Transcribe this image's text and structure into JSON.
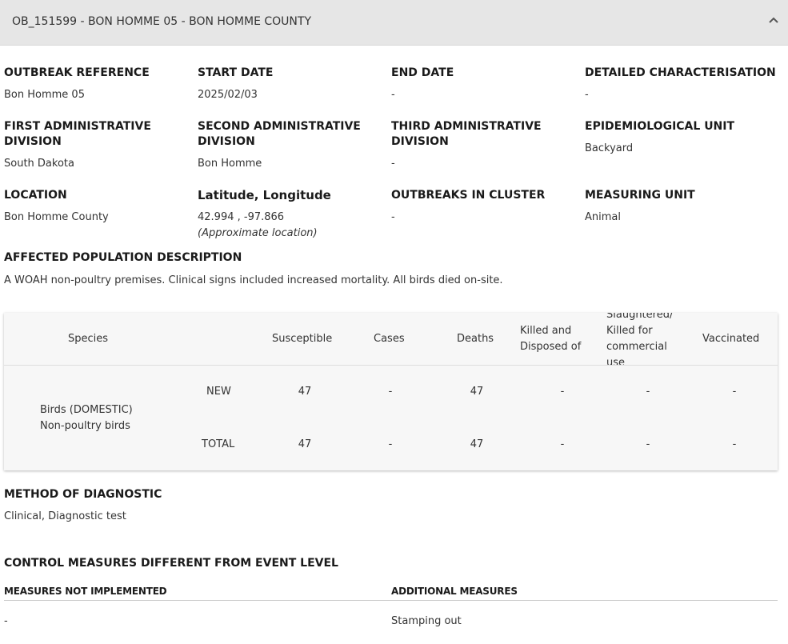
{
  "header": {
    "title": "OB_151599 - BON HOMME 05 - BON HOMME COUNTY"
  },
  "fields": {
    "outbreak_reference": {
      "label": "OUTBREAK REFERENCE",
      "value": "Bon Homme 05"
    },
    "start_date": {
      "label": "START DATE",
      "value": "2025/02/03"
    },
    "end_date": {
      "label": "END DATE",
      "value": "-"
    },
    "detailed_characterisation": {
      "label": "DETAILED CHARACTERISATION",
      "value": "-"
    },
    "first_admin": {
      "label_line1": "FIRST ADMINISTRATIVE",
      "label_line2": "DIVISION",
      "value": "South Dakota"
    },
    "second_admin": {
      "label_line1": "SECOND ADMINISTRATIVE",
      "label_line2": "DIVISION",
      "value": "Bon Homme"
    },
    "third_admin": {
      "label_line1": "THIRD ADMINISTRATIVE",
      "label_line2": "DIVISION",
      "value": "-"
    },
    "epidemiological_unit": {
      "label": "EPIDEMIOLOGICAL UNIT",
      "value": "Backyard"
    },
    "location": {
      "label": "LOCATION",
      "value": "Bon Homme County"
    },
    "lat_long": {
      "label": "Latitude, Longitude",
      "value": "42.994 , -97.866",
      "note": "(Approximate location)"
    },
    "outbreaks_in_cluster": {
      "label": "OUTBREAKS IN CLUSTER",
      "value": "-"
    },
    "measuring_unit": {
      "label": "MEASURING UNIT",
      "value": "Animal"
    }
  },
  "affected_population": {
    "label": "AFFECTED POPULATION DESCRIPTION",
    "text": "A WOAH non-poultry premises. Clinical signs included increased mortality. All birds died on-site."
  },
  "table": {
    "headers": {
      "species": "Species",
      "susceptible": "Susceptible",
      "cases": "Cases",
      "deaths": "Deaths",
      "killed_line1": "Killed and",
      "killed_line2": "Disposed of",
      "slaughtered_line1": "Slaughtered/",
      "slaughtered_line2": "Killed for",
      "slaughtered_line3": "commercial",
      "slaughtered_line4": "use",
      "vaccinated": "Vaccinated"
    },
    "species_line1": "Birds (DOMESTIC)",
    "species_line2": "Non-poultry birds",
    "rows": [
      {
        "label": "NEW",
        "susceptible": "47",
        "cases": "-",
        "deaths": "47",
        "killed": "-",
        "slaughtered": "-",
        "vaccinated": "-"
      },
      {
        "label": "TOTAL",
        "susceptible": "47",
        "cases": "-",
        "deaths": "47",
        "killed": "-",
        "slaughtered": "-",
        "vaccinated": "-"
      }
    ]
  },
  "diagnostic": {
    "label": "METHOD OF DIAGNOSTIC",
    "value": "Clinical, Diagnostic test"
  },
  "control_measures": {
    "label": "CONTROL MEASURES DIFFERENT FROM EVENT LEVEL",
    "not_implemented_label": "MEASURES NOT IMPLEMENTED",
    "not_implemented_value": "-",
    "additional_label": "ADDITIONAL MEASURES",
    "additional_value": "Stamping out"
  },
  "icons": {
    "collapse": "chevron-up-icon"
  },
  "colors": {
    "header_bg": "#e6e6e6",
    "table_bg": "#f7f7f7"
  }
}
